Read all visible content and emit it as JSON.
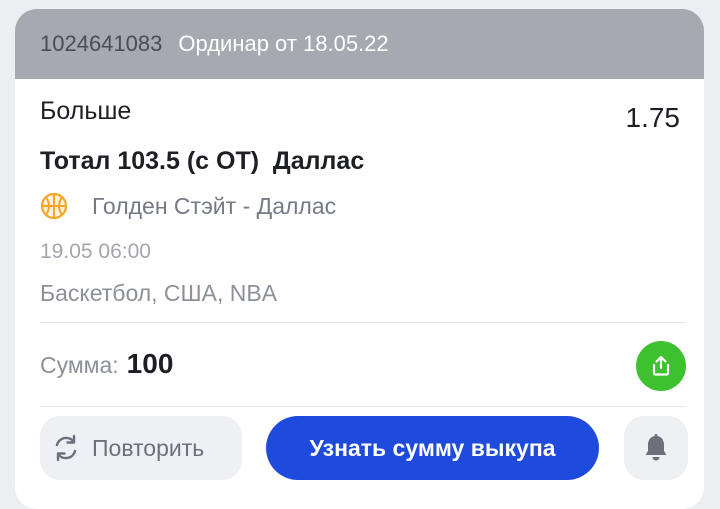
{
  "header": {
    "bet_id": "1024641083",
    "bet_type": "Ординар от 18.05.22"
  },
  "bet": {
    "outcome": "Больше",
    "odds": "1.75",
    "market": "Тотал 103.5 (с ОТ)  Даллас",
    "event_name": "Голден Стэйт - Даллас",
    "event_time": "19.05 06:00",
    "league": "Баскетбол, США, NBA",
    "sport_icon": "basketball-icon"
  },
  "sum": {
    "label": "Сумма:",
    "value": "100"
  },
  "actions": {
    "repeat_label": "Повторить",
    "buyout_label": "Узнать сумму выкупа",
    "share_icon": "share-icon",
    "bell_icon": "bell-icon"
  },
  "colors": {
    "header_bg": "#a7a9b1",
    "primary_blue": "#1e4bdc",
    "share_green": "#3dc12f",
    "basketball_orange": "#f5a623"
  }
}
